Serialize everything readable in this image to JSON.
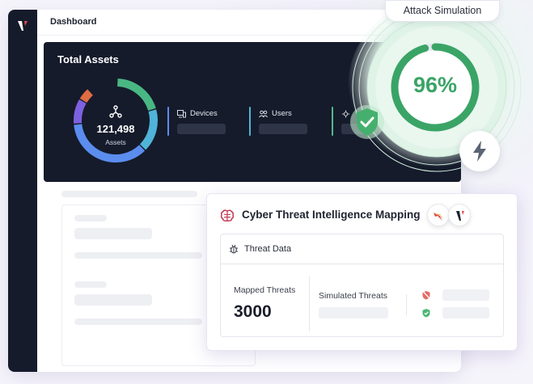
{
  "header": {
    "title": "Dashboard"
  },
  "assets": {
    "title": "Total Assets",
    "total": "121,498",
    "total_label": "Assets",
    "stats": [
      {
        "label": "Devices",
        "icon": "devices-icon",
        "color": "#5b8def"
      },
      {
        "label": "Users",
        "icon": "users-icon",
        "color": "#4fb4d8"
      },
      {
        "label": "",
        "icon": "gear-icon",
        "color": "#55b887"
      }
    ],
    "donut_segments": [
      {
        "color": "#49b783",
        "fraction": 0.2
      },
      {
        "color": "#4fb4d8",
        "fraction": 0.17
      },
      {
        "color": "#5b8def",
        "fraction": 0.36
      },
      {
        "color": "#7d61e0",
        "fraction": 0.1
      },
      {
        "color": "#e06c43",
        "fraction": 0.05
      }
    ]
  },
  "simulation": {
    "label": "Attack Simulation",
    "score": "96%",
    "score_fraction": 0.96,
    "accent": "#3aa466"
  },
  "cti": {
    "title": "Cyber Threat Intelligence Mapping",
    "section": "Threat Data",
    "mapped_label": "Mapped Threats",
    "mapped_value": "3000",
    "simulated_label": "Simulated Threats"
  },
  "icons": {
    "brain": "brain-icon",
    "bug": "bug-icon",
    "bolt": "lightning-icon",
    "shield": "shield-check-icon",
    "network": "network-icon"
  }
}
